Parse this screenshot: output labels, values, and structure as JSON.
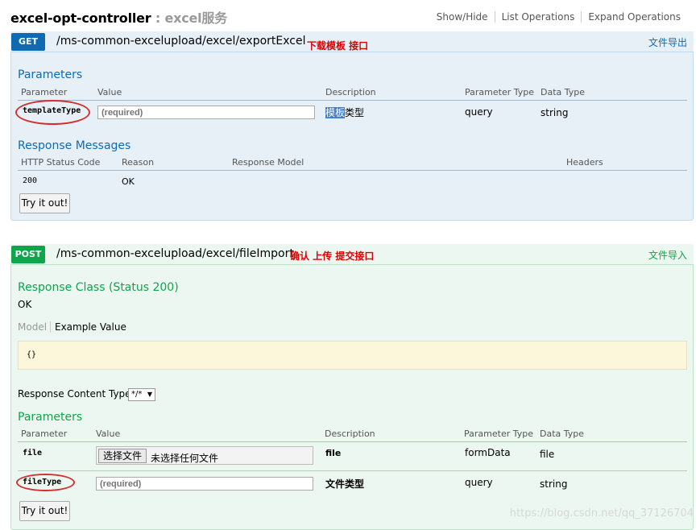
{
  "header": {
    "controller_name": "excel-opt-controller",
    "controller_desc": "excel服务",
    "separator": " : ",
    "links": [
      "Show/Hide",
      "List Operations",
      "Expand Operations"
    ]
  },
  "get_op": {
    "method": "GET",
    "path": "/ms-common-excelupload/excel/exportExcel",
    "note": "下载模板 接口",
    "summary": "文件导出",
    "parameters_title": "Parameters",
    "param_headers": [
      "Parameter",
      "Value",
      "Description",
      "Parameter Type",
      "Data Type"
    ],
    "param": {
      "name": "templateType",
      "placeholder": "(required)",
      "desc_highlight": "模板",
      "desc_rest": "类型",
      "type": "query",
      "data_type": "string"
    },
    "response_title": "Response Messages",
    "response_headers": [
      "HTTP Status Code",
      "Reason",
      "Response Model",
      "Headers"
    ],
    "response_row": {
      "code": "200",
      "reason": "OK"
    },
    "try_button": "Try it out!"
  },
  "post_op": {
    "method": "POST",
    "path": "/ms-common-excelupload/excel/fileImport",
    "note": "确认 上传 提交接口",
    "summary": "文件导入",
    "response_class_title": "Response Class (Status 200)",
    "response_class_value": "OK",
    "model_tab": "Model",
    "example_tab": "Example Value",
    "example_value": "{}",
    "content_type_label": "Response Content Type",
    "content_type_value": "*/*",
    "parameters_title": "Parameters",
    "param_headers": [
      "Parameter",
      "Value",
      "Description",
      "Parameter Type",
      "Data Type"
    ],
    "params": [
      {
        "name": "file",
        "file_button": "选择文件",
        "file_status": "未选择任何文件",
        "desc": "file",
        "type": "formData",
        "data_type": "file"
      },
      {
        "name": "fileType",
        "placeholder": "(required)",
        "desc": "文件类型",
        "type": "query",
        "data_type": "string"
      }
    ],
    "try_button": "Try it out!"
  },
  "watermark": "https://blog.csdn.net/qq_37126704",
  "colors": {
    "get": "#0f6ab4",
    "post": "#10a54a",
    "note": "#e00000",
    "annotation": "#d32f2f"
  }
}
